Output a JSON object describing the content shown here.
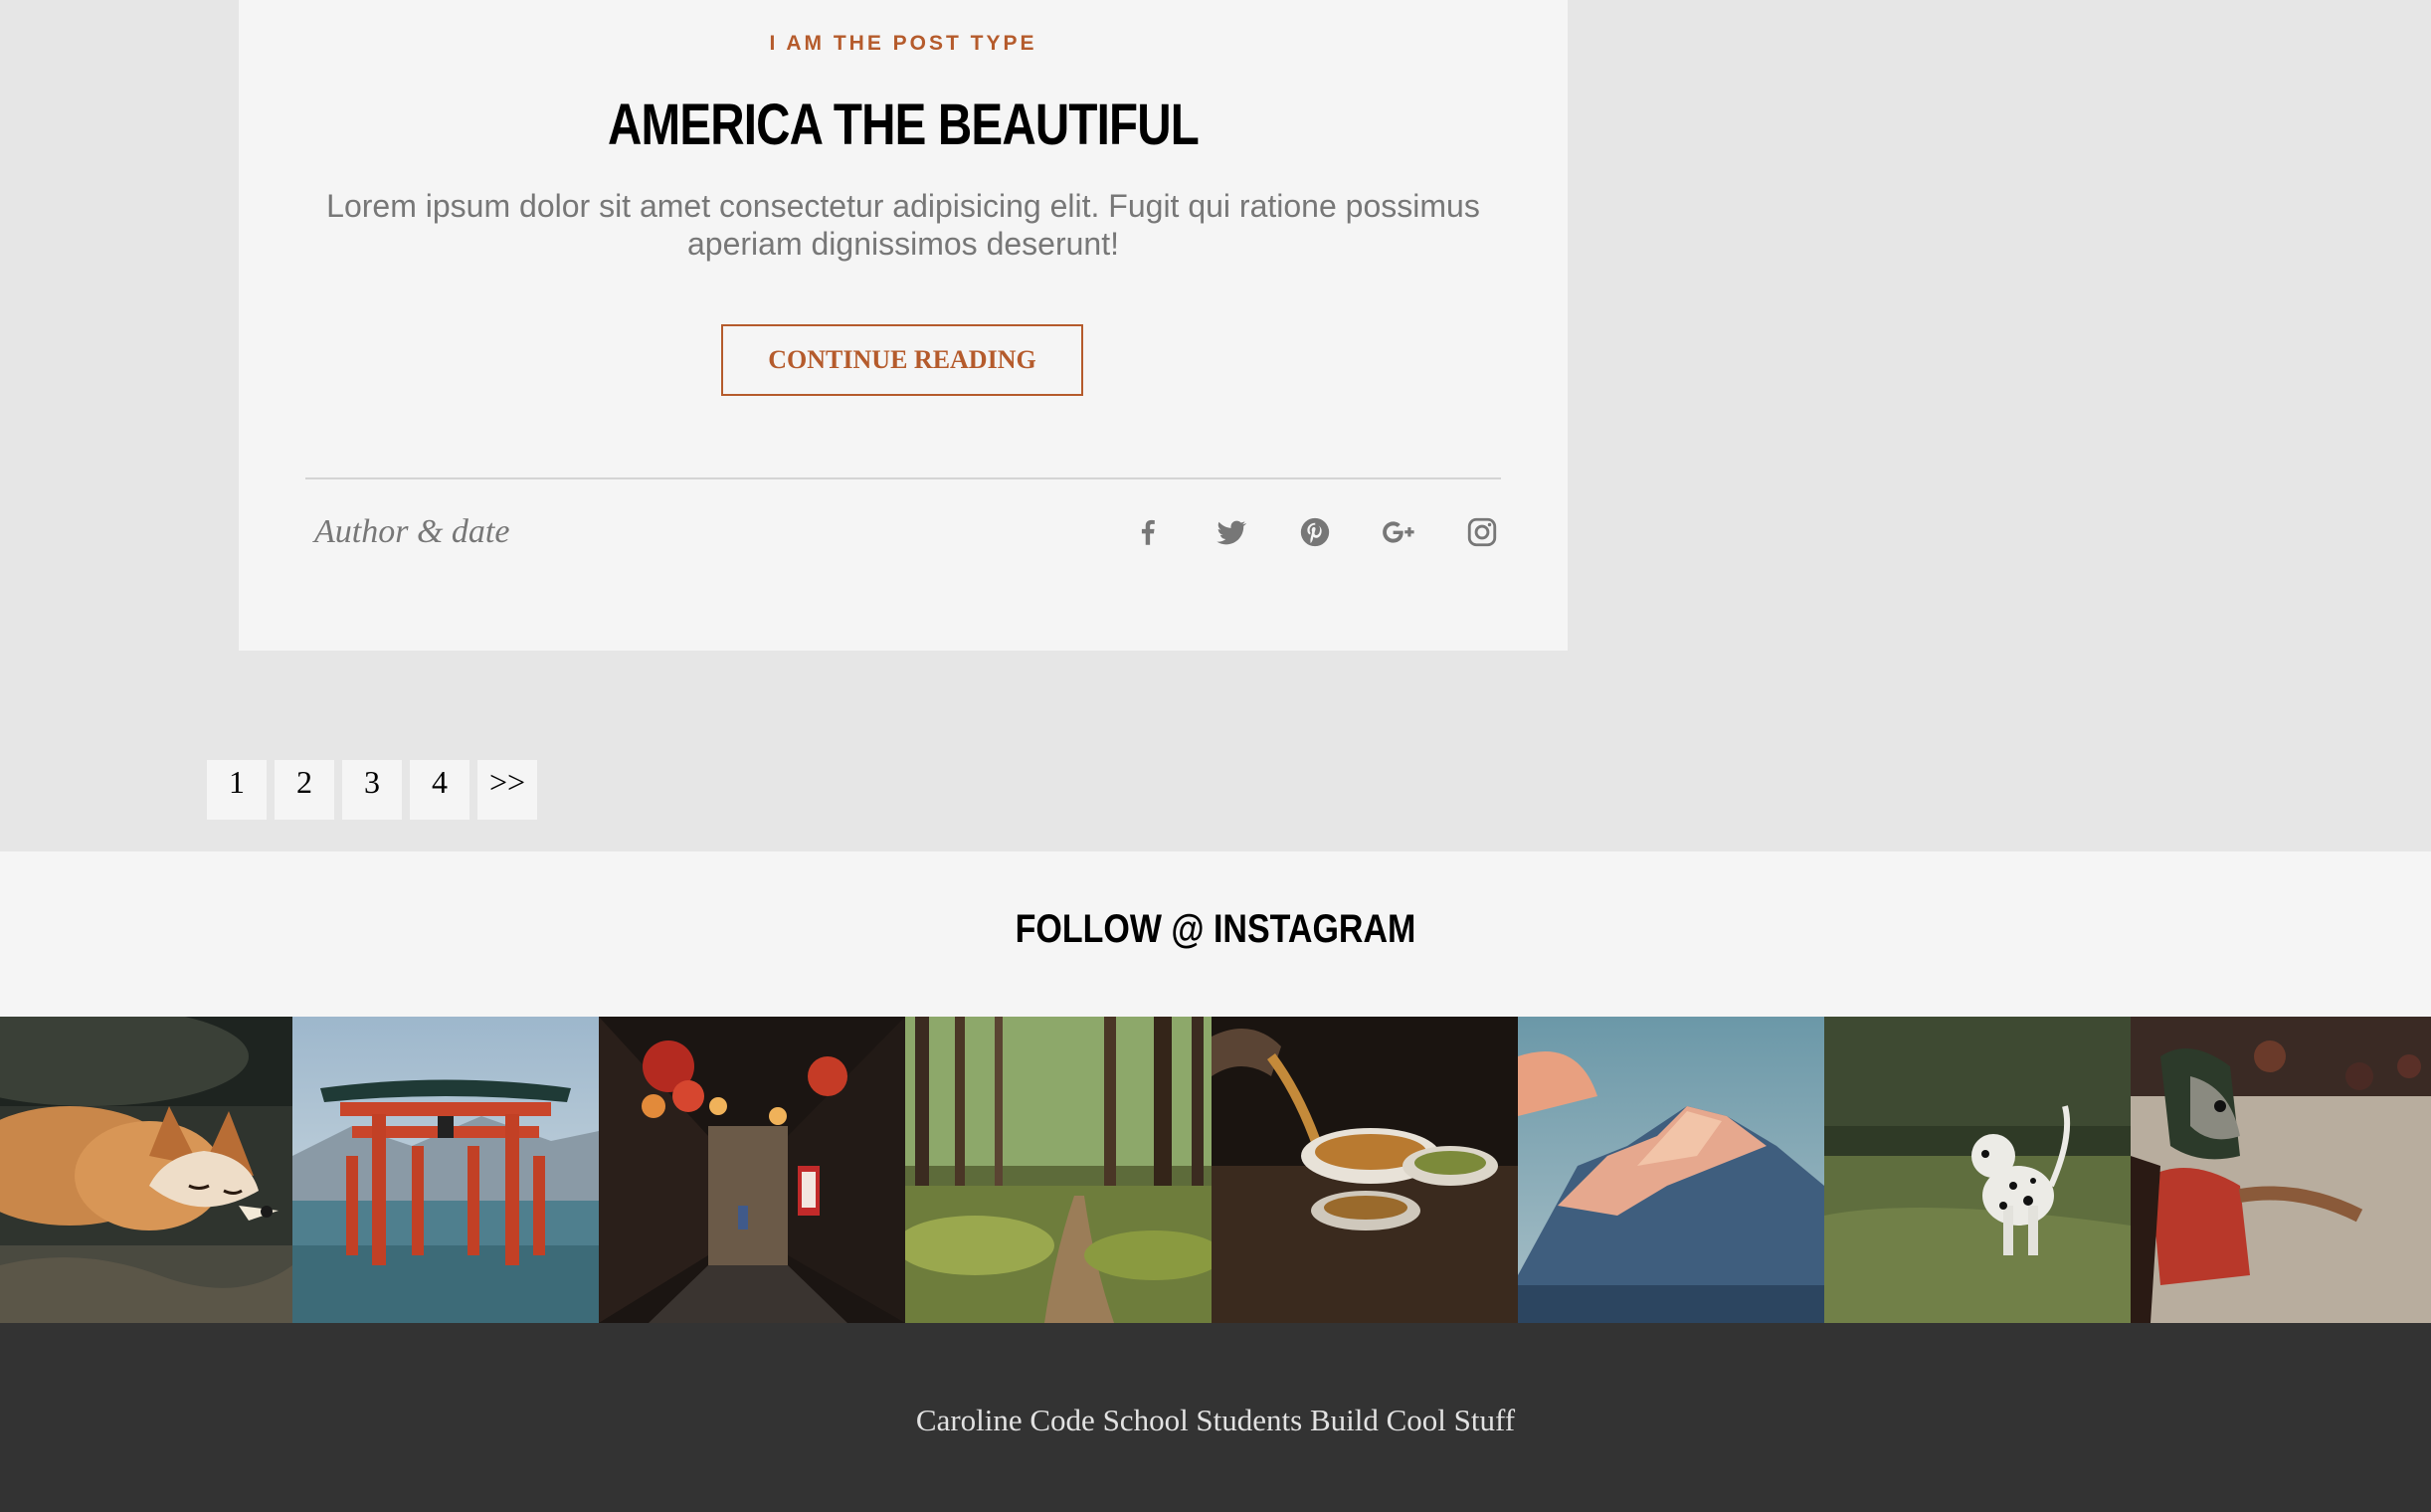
{
  "post": {
    "type_label": "I AM THE POST TYPE",
    "title": "AMERICA THE BEAUTIFUL",
    "excerpt": "Lorem ipsum dolor sit amet consectetur adipisicing elit. Fugit qui ratione possimus aperiam dignissimos deserunt!",
    "continue_label": "CONTINUE READING",
    "meta": "Author & date",
    "share_icons": [
      "facebook-icon",
      "twitter-icon",
      "pinterest-icon",
      "google-plus-icon",
      "instagram-icon"
    ]
  },
  "pagination": {
    "pages": [
      "1",
      "2",
      "3",
      "4"
    ],
    "next_label": ">>"
  },
  "instagram": {
    "title": "FOLLOW @ INSTAGRAM",
    "photos": [
      "sleeping-fox",
      "torii-gate-in-water",
      "lantern-alley",
      "forest-path",
      "tea-pouring",
      "mountain-peak",
      "dalmatian-in-field",
      "masked-dancer"
    ]
  },
  "footer": {
    "text": "Caroline Code School Students Build Cool Stuff"
  },
  "colors": {
    "accent": "#b55b2c",
    "page_bg": "#e6e6e6",
    "card_bg": "#f5f5f5",
    "footer_bg": "#333333",
    "muted_text": "#777777"
  }
}
